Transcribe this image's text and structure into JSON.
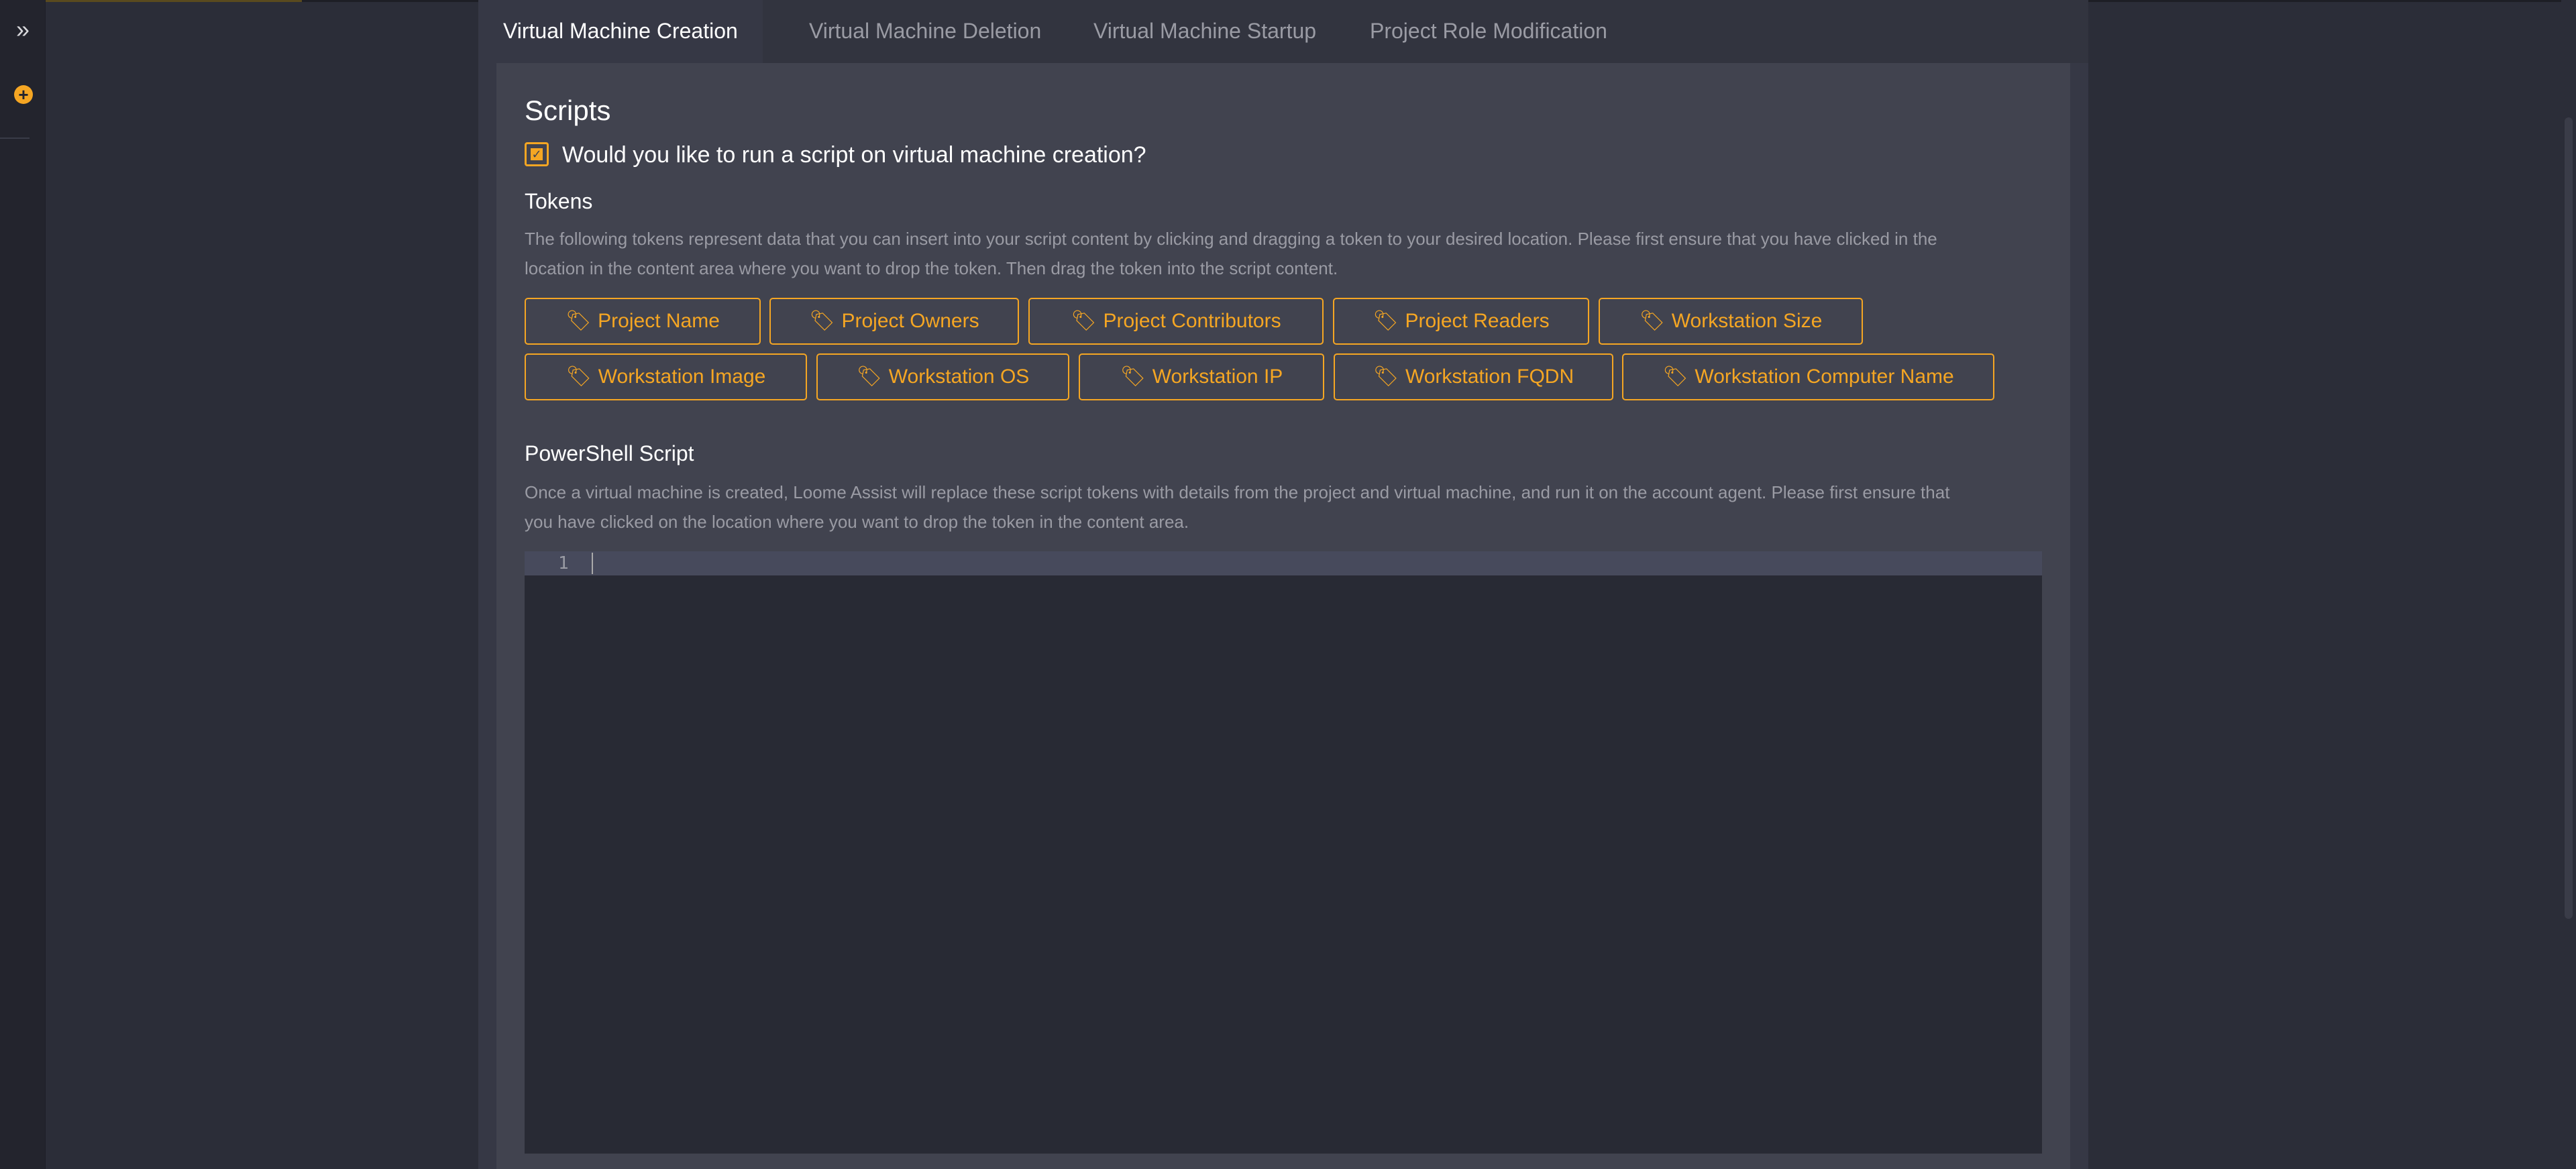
{
  "tabs": [
    {
      "label": "Virtual Machine Creation",
      "active": true
    },
    {
      "label": "Virtual Machine Deletion",
      "active": false
    },
    {
      "label": "Virtual Machine Startup",
      "active": false
    },
    {
      "label": "Project Role Modification",
      "active": false
    }
  ],
  "scripts": {
    "heading": "Scripts",
    "checkbox_label": "Would you like to run a script on virtual machine creation?",
    "checkbox_checked": true
  },
  "tokens": {
    "heading": "Tokens",
    "description_line1": "The following tokens represent data that you can insert into your script content by clicking and dragging a token to your desired location. Please first ensure that you have clicked in the",
    "description_line2": "location in the content area where you want to drop the token. Then drag the token into the script content.",
    "items": [
      "Project Name",
      "Project Owners",
      "Project Contributors",
      "Project Readers",
      "Workstation Size",
      "Workstation Image",
      "Workstation OS",
      "Workstation IP",
      "Workstation FQDN",
      "Workstation Computer Name"
    ]
  },
  "powershell": {
    "heading": "PowerShell Script",
    "description_line1": "Once a virtual machine is created, Loome Assist will replace these script tokens with details from the project and virtual machine, and run it on the account agent. Please first ensure that",
    "description_line2": "you have clicked on the location where you want to drop the token in the content area.",
    "line_number": "1"
  },
  "colors": {
    "accent": "#f5a623",
    "background": "#2b2d38",
    "panel": "#41434f"
  }
}
